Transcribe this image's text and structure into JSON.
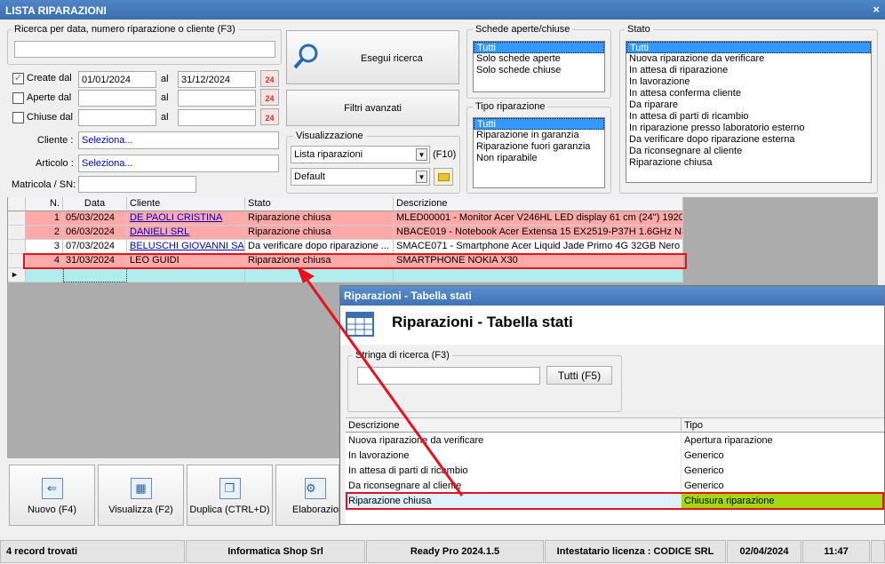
{
  "window": {
    "title": "LISTA RIPARAZIONI",
    "close_glyph": "×"
  },
  "search": {
    "label": "Ricerca per data, numero riparazione o cliente (F3)",
    "value": "",
    "button": "Esegui ricerca"
  },
  "dates": {
    "created": {
      "label": "Create dal",
      "checked": true,
      "from": "01/01/2024",
      "to": "31/12/2024"
    },
    "opened": {
      "label": "Aperte dal",
      "checked": false,
      "from": "",
      "to": ""
    },
    "closed": {
      "label": "Chiuse dal",
      "checked": false,
      "from": "",
      "to": ""
    },
    "al_label": "al",
    "cal_text": "24"
  },
  "advanced_filters": "Filtri avanzati",
  "cliente": {
    "label": "Cliente :",
    "value": "Seleziona..."
  },
  "articolo": {
    "label": "Articolo :",
    "value": "Seleziona..."
  },
  "matricola": {
    "label": "Matricola / SN:",
    "value": ""
  },
  "visualizzazione": {
    "label": "Visualizzazione",
    "view": "Lista riparazioni",
    "hotkey": "(F10)",
    "layout": "Default"
  },
  "schede": {
    "label": "Schede aperte/chiuse",
    "items": [
      "Tutti",
      "Solo schede aperte",
      "Solo schede chiuse"
    ]
  },
  "tipo": {
    "label": "Tipo riparazione",
    "items": [
      "Tutti",
      "Riparazione in garanzia",
      "Riparazione fuori garanzia",
      "Non riparabile"
    ]
  },
  "stato": {
    "label": "Stato",
    "items": [
      "Tutti",
      "Nuova riparazione da verificare",
      "In attesa di riparazione",
      "In lavorazione",
      "In attesa conferma cliente",
      "Da riparare",
      "In attesa di parti di ricambio",
      "In riparazione presso laboratorio esterno",
      "Da verificare dopo riparazione esterna",
      "Da riconsegnare al cliente",
      "Riparazione chiusa"
    ]
  },
  "grid": {
    "headers": [
      "N.",
      "Data",
      "Cliente",
      "Stato",
      "Descrizione"
    ],
    "rows": [
      {
        "n": "1",
        "data": "05/03/2024",
        "cliente": "DE PAOLI CRISTINA",
        "stato": "Riparazione chiusa",
        "descrizione": "MLED00001 - Monitor Acer V246HL LED display 61 cm (24\") 1920 ..."
      },
      {
        "n": "2",
        "data": "06/03/2024",
        "cliente": "DANIELI SRL",
        "stato": "Riparazione chiusa",
        "descrizione": "NBACE019 - Notebook Acer Extensa 15 EX2519-P37H 1.6GHz N3..."
      },
      {
        "n": "3",
        "data": "07/03/2024",
        "cliente": "BELUSCHI GIOVANNI SAS",
        "stato": "Da verificare dopo riparazione ...",
        "descrizione": "SMACE071 - Smartphone Acer Liquid Jade Primo 4G 32GB Nero"
      },
      {
        "n": "4",
        "data": "31/03/2024",
        "cliente": "LEO GUIDI",
        "stato": "Riparazione chiusa",
        "descrizione": "SMARTPHONE NOKIA X30"
      }
    ],
    "new_row_marker": "►"
  },
  "toolbar": {
    "nuovo": "Nuovo (F4)",
    "visualizza": "Visualizza (F2)",
    "duplica": "Duplica (CTRL+D)",
    "elabora": "Elaborazion"
  },
  "statusbar": {
    "records": "4 record trovati",
    "company": "Informatica Shop Srl",
    "version": "Ready Pro 2024.1.5",
    "license": "Intestatario licenza : CODICE SRL",
    "date": "02/04/2024",
    "time": "11:47"
  },
  "dialog": {
    "title": "Riparazioni - Tabella stati",
    "heading": "Riparazioni - Tabella stati",
    "search_label": "Stringa di ricerca (F3)",
    "search_value": "",
    "all_button": "Tutti (F5)",
    "headers": [
      "Descrizione",
      "Tipo"
    ],
    "rows": [
      {
        "descrizione": "Nuova riparazione da verificare",
        "tipo": "Apertura riparazione"
      },
      {
        "descrizione": "In lavorazione",
        "tipo": "Generico"
      },
      {
        "descrizione": "In attesa di parti di ricambio",
        "tipo": "Generico"
      },
      {
        "descrizione": "Da riconsegnare al cliente",
        "tipo": "Generico"
      },
      {
        "descrizione": "Riparazione chiusa",
        "tipo": "Chiusura riparazione"
      }
    ]
  },
  "colors": {
    "closed_row": "#ffa9a9",
    "highlight": "#e8101a",
    "chiusura": "#a6d80f",
    "title_bar": "#3a6fb0"
  }
}
